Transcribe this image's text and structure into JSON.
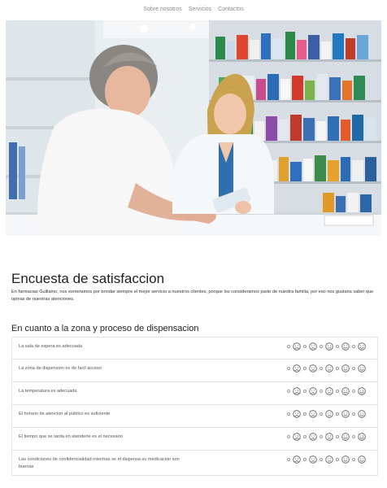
{
  "nav": {
    "items": [
      "Sobre nosotros",
      "Servicios",
      "Contactos"
    ]
  },
  "hero": {
    "alt": "Farmaceutica atendiendo a una clienta en el mostrador de la farmacia"
  },
  "page": {
    "title": "Encuesta de satisfaccion",
    "intro": "En farmacias Guillamo, nos esmeramos por brindar siempre el mejor servicio a nuestros clientes, porque los consideramos parte de nuestra familia, por eso nos gustaria saber que opinas de nuestras atenciones."
  },
  "section": {
    "title": "En cuanto a la zona y proceso de dispensacion",
    "questions": [
      "La sala de espera es adecuada",
      "La zona de dispension es de facil acceso",
      "La temperatura es adecuada",
      "El horario de atencion al publico es suficiente",
      "El tiempo que se tarda en atenderle es el necesario",
      "Las condiciones de confidencialidad mientras se el dispensa su medicacion son buenas"
    ]
  },
  "rating_scale": [
    "very-sad-icon",
    "sad-icon",
    "neutral-icon",
    "happy-icon",
    "very-happy-icon"
  ],
  "colors": {
    "accent_face": "#555555",
    "border": "#e3e3e3"
  }
}
